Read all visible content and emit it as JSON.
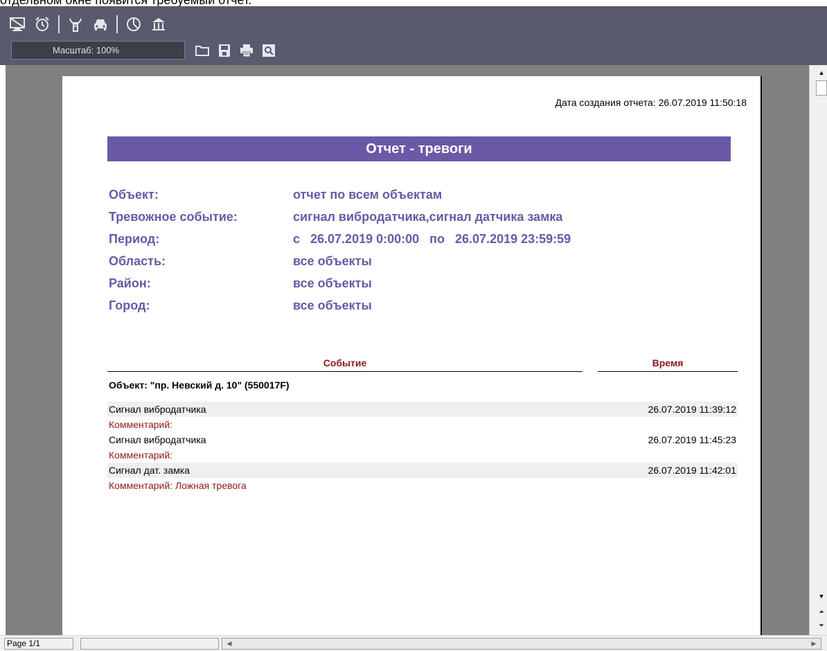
{
  "caption": "отдельном окне появится требуемый отчет.",
  "toolbar": {
    "icons": [
      "monitor-icon",
      "alarm-clock-icon",
      "antenna-icon",
      "car-icon",
      "pie-chart-icon",
      "building-icon"
    ],
    "zoom_label": "Масштаб: 100%",
    "actions": [
      "open-folder-icon",
      "save-icon",
      "print-icon",
      "preview-icon"
    ]
  },
  "report": {
    "created": "Дата создания отчета: 26.07.2019 11:50:18",
    "title": "Отчет - тревоги",
    "params": [
      {
        "label": "Объект:",
        "value": "отчет по всем объектам"
      },
      {
        "label": "Тревожное событие:",
        "value": "сигнал вибродатчика,сигнал датчика замка"
      },
      {
        "label": "Период:",
        "value": "с   26.07.2019 0:00:00   по   26.07.2019 23:59:59"
      },
      {
        "label": "Область:",
        "value": "все объекты"
      },
      {
        "label": "Район:",
        "value": "все объекты"
      },
      {
        "label": "Город:",
        "value": "все объекты"
      }
    ],
    "columns": {
      "event": "Событие",
      "time": "Время"
    },
    "object_title": "Объект: \"пр. Невский д. 10\" (550017F)",
    "events": [
      {
        "event": "Сигнал вибродатчика",
        "time": "26.07.2019 11:39:12",
        "comment": "Комментарий:"
      },
      {
        "event": "Сигнал вибродатчика",
        "time": "26.07.2019 11:45:23",
        "comment": "Комментарий:"
      },
      {
        "event": "Сигнал дат. замка",
        "time": "26.07.2019 11:42:01",
        "comment": "Комментарий: Ложная тревога"
      }
    ]
  },
  "status": {
    "page": "Page 1/1"
  }
}
